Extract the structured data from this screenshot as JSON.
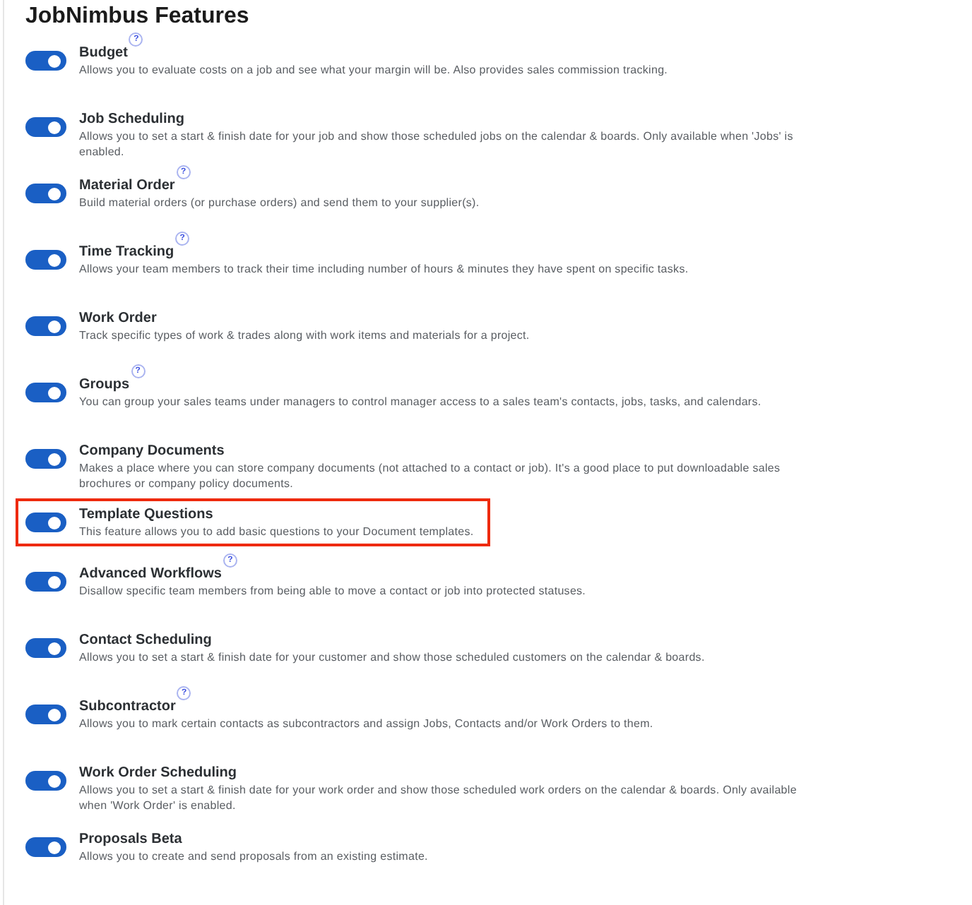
{
  "title": "JobNimbus Features",
  "features": [
    {
      "name": "Budget",
      "description": "Allows you to evaluate costs on a job and see what your margin will be. Also provides sales commission tracking.",
      "on": true,
      "help": "?",
      "highlighted": false
    },
    {
      "name": "Job Scheduling",
      "description": "Allows you to set a start & finish date for your job and show those scheduled jobs on the calendar & boards. Only available when 'Jobs' is enabled.",
      "on": true,
      "highlighted": false
    },
    {
      "name": "Material Order",
      "description": "Build material orders (or purchase orders) and send them to your supplier(s).",
      "on": true,
      "help": "?",
      "highlighted": false
    },
    {
      "name": "Time Tracking",
      "description": "Allows your team members to track their time including number of hours & minutes they have spent on specific tasks.",
      "on": true,
      "help": "?",
      "highlighted": false
    },
    {
      "name": "Work Order",
      "description": "Track specific types of work & trades along with work items and materials for a project.",
      "on": true,
      "highlighted": false
    },
    {
      "name": "Groups",
      "description": "You can group your sales teams under managers to control manager access to a sales team's contacts, jobs, tasks, and calendars.",
      "on": true,
      "help": "?",
      "highlighted": false
    },
    {
      "name": "Company Documents",
      "description": "Makes a place where you can store company documents (not attached to a contact or job). It's a good place to put downloadable sales brochures or company policy documents.",
      "on": true,
      "highlighted": false
    },
    {
      "name": "Template Questions",
      "description": "This feature allows you to add basic questions to your Document templates.",
      "on": true,
      "highlighted": true
    },
    {
      "name": "Advanced Workflows",
      "description": "Disallow specific team members from being able to move a contact or job into protected statuses.",
      "on": true,
      "help": "?",
      "highlighted": false
    },
    {
      "name": "Contact Scheduling",
      "description": "Allows you to set a start & finish date for your customer and show those scheduled customers on the calendar & boards.",
      "on": true,
      "highlighted": false
    },
    {
      "name": "Subcontractor",
      "description": "Allows you to mark certain contacts as subcontractors and assign Jobs, Contacts and/or Work Orders to them.",
      "on": true,
      "help": "?",
      "highlighted": false
    },
    {
      "name": "Work Order Scheduling",
      "description": "Allows you to set a start & finish date for your work order and show those scheduled work orders on the calendar & boards. Only available when 'Work Order' is enabled.",
      "on": true,
      "highlighted": false
    },
    {
      "name": "Proposals Beta",
      "description": "Allows you to create and send proposals from an existing estimate.",
      "on": true,
      "highlighted": false
    }
  ]
}
